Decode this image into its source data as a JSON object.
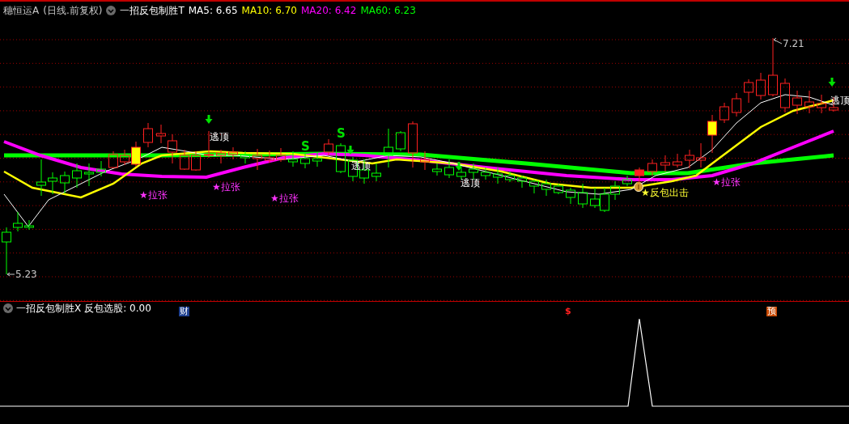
{
  "header": {
    "stock": "穗恒运A",
    "period": "(日线.前复权)",
    "indicator": "一招反包制胜T",
    "ma": [
      {
        "label": "MA5: 6.65",
        "color": "#ffffff"
      },
      {
        "label": "MA10: 6.70",
        "color": "#ffff00"
      },
      {
        "label": "MA20: 6.42",
        "color": "#ff00ff"
      },
      {
        "label": "MA60: 6.23",
        "color": "#00ff00"
      }
    ]
  },
  "main_chart": {
    "high_label": "7.21",
    "low_label": "5.23",
    "signals": [
      {
        "kind": "surge",
        "text": "★拉张"
      },
      {
        "kind": "escape",
        "text": "逃顶",
        "arrow": true
      },
      {
        "kind": "surge",
        "text": "★拉张"
      },
      {
        "kind": "surge",
        "text": "★拉张"
      },
      {
        "kind": "s",
        "text": "S"
      },
      {
        "kind": "s",
        "text": "S"
      },
      {
        "kind": "escape",
        "text": "逃顶",
        "arrow": true
      },
      {
        "kind": "escape",
        "text": "逃顶",
        "arrow": true
      },
      {
        "kind": "buy",
        "text": "★反包出击"
      },
      {
        "kind": "surge",
        "text": "★拉张"
      },
      {
        "kind": "escape",
        "text": "逃顶",
        "arrow": true
      }
    ]
  },
  "event_markers": [
    {
      "kind": "finance",
      "text": "财"
    },
    {
      "kind": "dollar",
      "text": "$"
    },
    {
      "kind": "forecast",
      "text": "预"
    }
  ],
  "lower_panel": {
    "indicator": "一招反包制胜X",
    "reading": "反包选股: 0.00"
  }
}
